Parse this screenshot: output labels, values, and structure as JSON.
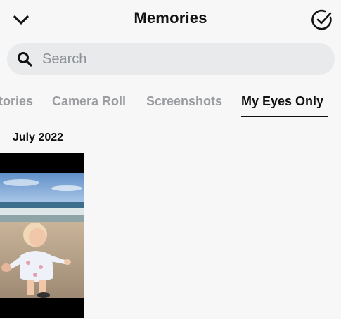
{
  "header": {
    "title": "Memories",
    "back_icon": "chevron-down-icon",
    "select_icon": "check-circle-icon"
  },
  "search": {
    "placeholder": "Search",
    "value": "",
    "icon": "search-icon"
  },
  "tabs": [
    {
      "label": "Stories",
      "active": false
    },
    {
      "label": "Camera Roll",
      "active": false
    },
    {
      "label": "Screenshots",
      "active": false
    },
    {
      "label": "My Eyes Only",
      "active": true
    }
  ],
  "section": {
    "title": "July 2022"
  },
  "colors": {
    "background": "#f7f7f8",
    "search_bg": "#e9eaec",
    "inactive_tab": "#9a9ca1",
    "active_tab": "#111111"
  }
}
